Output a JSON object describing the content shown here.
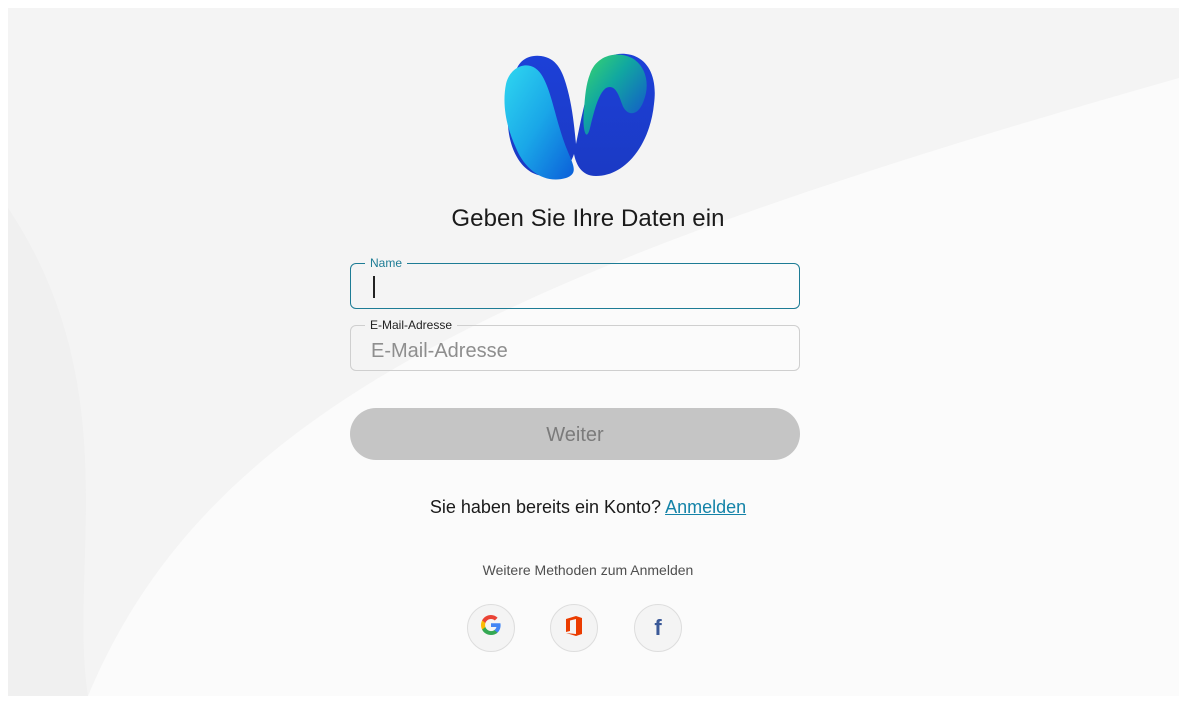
{
  "page": {
    "title": "Geben Sie Ihre Daten ein"
  },
  "form": {
    "name": {
      "label": "Name",
      "value": "",
      "placeholder": ""
    },
    "email": {
      "label": "E-Mail-Adresse",
      "value": "",
      "placeholder": "E-Mail-Adresse"
    },
    "submit_label": "Weiter"
  },
  "account": {
    "prompt": "Sie haben bereits ein Konto?",
    "link_label": "Anmelden"
  },
  "alt_methods": {
    "label": "Weitere Methoden zum Anmelden",
    "providers": [
      {
        "name": "Google",
        "icon": "google-icon",
        "glyph": "G"
      },
      {
        "name": "Office 365",
        "icon": "office-icon"
      },
      {
        "name": "Facebook",
        "icon": "facebook-icon",
        "glyph": "f"
      }
    ]
  },
  "colors": {
    "accent": "#1d7c95",
    "link": "#1483a8",
    "button_disabled_bg": "#c5c5c5",
    "button_disabled_text": "#7b7b7b",
    "background": "#f4f4f4",
    "google_blue": "#4285f4",
    "google_red": "#ea4335",
    "google_yellow": "#fbbc05",
    "google_green": "#34a853",
    "office_red": "#eb3c00",
    "facebook_blue": "#3b5998"
  }
}
